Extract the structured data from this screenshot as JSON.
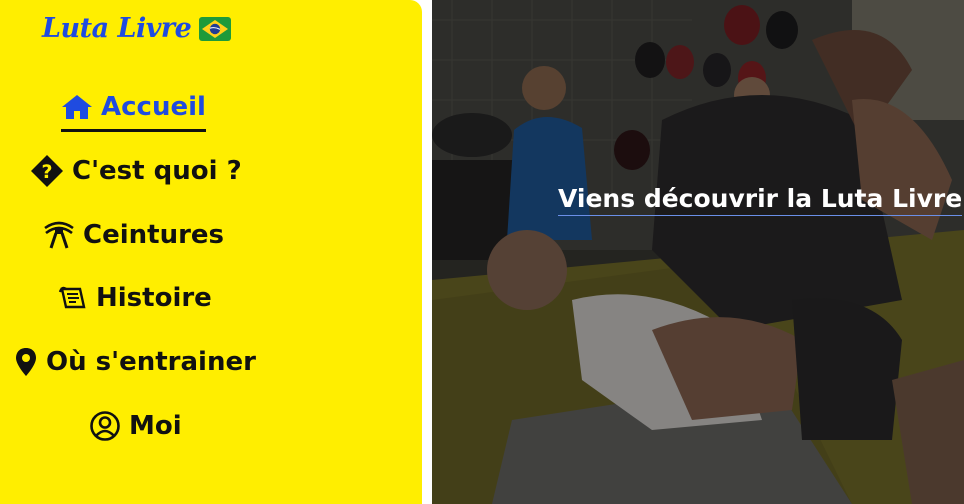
{
  "brand": {
    "name": "Luta Livre",
    "flag_icon": "brazil-flag-icon",
    "color": "#1f4be0"
  },
  "nav": {
    "items": [
      {
        "label": "Accueil",
        "icon": "home-icon",
        "active": true
      },
      {
        "label": "C'est quoi ?",
        "icon": "unknown-glyph-icon",
        "active": false
      },
      {
        "label": "Ceintures",
        "icon": "belt-icon",
        "active": false
      },
      {
        "label": "Histoire",
        "icon": "scroll-icon",
        "active": false
      },
      {
        "label": "Où s'entrainer",
        "icon": "map-pin-icon",
        "active": false
      },
      {
        "label": "Moi",
        "icon": "user-circle-icon",
        "active": false
      }
    ]
  },
  "hero": {
    "link_text": "Viens découvrir la Luta Livre"
  },
  "colors": {
    "sidebar_bg": "#ffee00",
    "active_link": "#1f4be0",
    "text": "#111111"
  }
}
